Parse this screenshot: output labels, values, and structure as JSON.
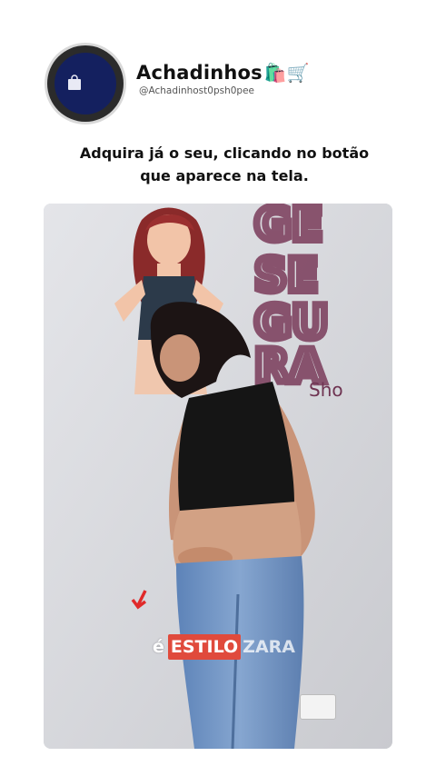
{
  "profile": {
    "name": "Achadinhos",
    "name_emoji": "🛍️🛒",
    "handle": "@Achadinhost0psh0pee"
  },
  "caption": {
    "line1": "Adquira já o seu, clicando  no botão",
    "line2": "que aparece na tela."
  },
  "video": {
    "overlay_prefix": "é",
    "overlay_highlight": "ESTILO",
    "overlay_suffix": "ZARA",
    "wall_letters": [
      "SE",
      "GU",
      "RA"
    ],
    "wall_small": "Sho"
  },
  "colors": {
    "highlight": "#e04a3c",
    "wall_letters": "#7a3b5a",
    "top": "#151515",
    "jeans": "#6f93c2"
  }
}
